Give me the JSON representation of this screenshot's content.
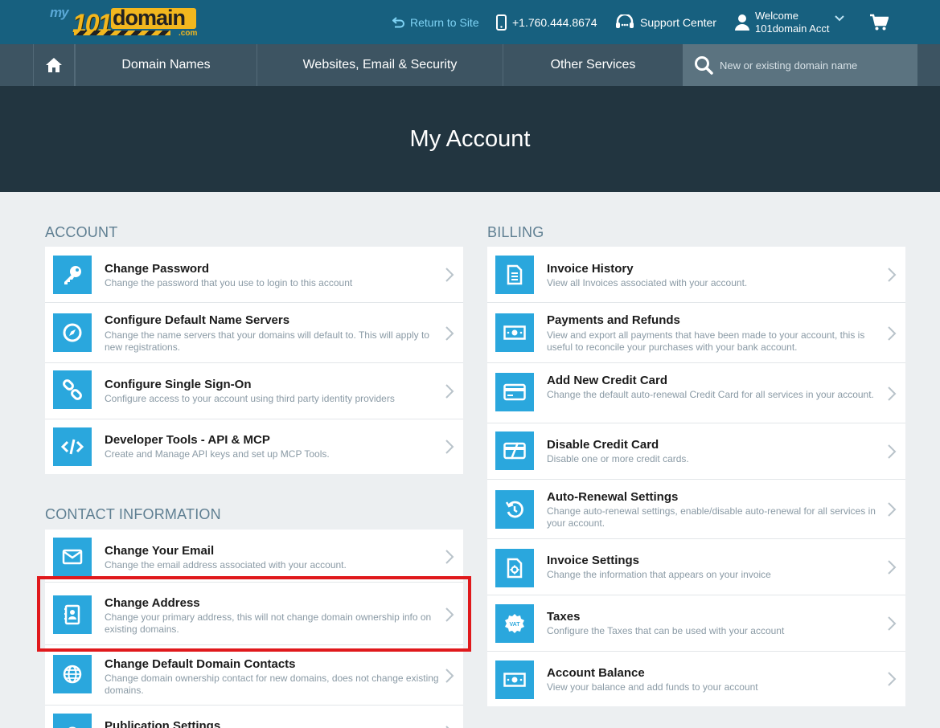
{
  "topbar": {
    "logo": {
      "my": "my",
      "num": "101",
      "domain": "domain",
      "com": ".com"
    },
    "return_label": "Return to Site",
    "phone": "+1.760.444.8674",
    "support_label": "Support Center",
    "welcome_line1": "Welcome",
    "welcome_line2": "101domain Acct"
  },
  "nav": {
    "domain_names": "Domain Names",
    "websites": "Websites, Email & Security",
    "other": "Other Services",
    "search_placeholder": "New or existing domain name"
  },
  "hero": {
    "title": "My Account"
  },
  "account": {
    "heading": "ACCOUNT",
    "items": [
      {
        "icon": "key-icon",
        "title": "Change Password",
        "desc": "Change the password that you use to login to this account"
      },
      {
        "icon": "compass-icon",
        "title": "Configure Default Name Servers",
        "desc": "Change the name servers that your domains will default to. This will apply to new registrations."
      },
      {
        "icon": "link-icon",
        "title": "Configure Single Sign-On",
        "desc": "Configure access to your account using third party identity providers"
      },
      {
        "icon": "code-icon",
        "title": "Developer Tools - API & MCP",
        "desc": "Create and Manage API keys and set up MCP Tools."
      }
    ]
  },
  "contact": {
    "heading": "CONTACT INFORMATION",
    "items": [
      {
        "icon": "envelope-icon",
        "title": "Change Your Email",
        "desc": "Change the email address associated with your account."
      },
      {
        "icon": "address-book-icon",
        "title": "Change Address",
        "desc": "Change your primary address, this will not change domain ownership info on existing domains."
      },
      {
        "icon": "globe-icon",
        "title": "Change Default Domain Contacts",
        "desc": "Change domain ownership contact for new domains, does not change existing domains."
      },
      {
        "icon": "publication-icon",
        "title": "Publication Settings",
        "desc": ""
      }
    ]
  },
  "billing": {
    "heading": "BILLING",
    "items": [
      {
        "icon": "invoice-icon",
        "title": "Invoice History",
        "desc": "View all Invoices associated with your account."
      },
      {
        "icon": "money-icon",
        "title": "Payments and Refunds",
        "desc": "View and export all payments that have been made to your account, this is useful to reconcile your purchases with your bank account."
      },
      {
        "icon": "credit-card-icon",
        "title": "Add New Credit Card",
        "desc": "Change the default auto-renewal Credit Card for all services in your account."
      },
      {
        "icon": "disabled-card-icon",
        "title": "Disable Credit Card",
        "desc": "Disable one or more credit cards."
      },
      {
        "icon": "renew-icon",
        "title": "Auto-Renewal Settings",
        "desc": "Change auto-renewal settings, enable/disable auto-renewal for all services in your account."
      },
      {
        "icon": "invoice-settings-icon",
        "title": "Invoice Settings",
        "desc": "Change the information that appears on your invoice"
      },
      {
        "icon": "vat-icon",
        "title": "Taxes",
        "desc": "Configure the Taxes that can be used with your account"
      },
      {
        "icon": "balance-icon",
        "title": "Account Balance",
        "desc": "View your balance and add funds to your account"
      }
    ]
  },
  "colors": {
    "topbar": "#17607f",
    "navbar": "#3d5462",
    "hero": "#223540",
    "icon_bg": "#2aa7dd",
    "highlight": "#e0191c"
  }
}
